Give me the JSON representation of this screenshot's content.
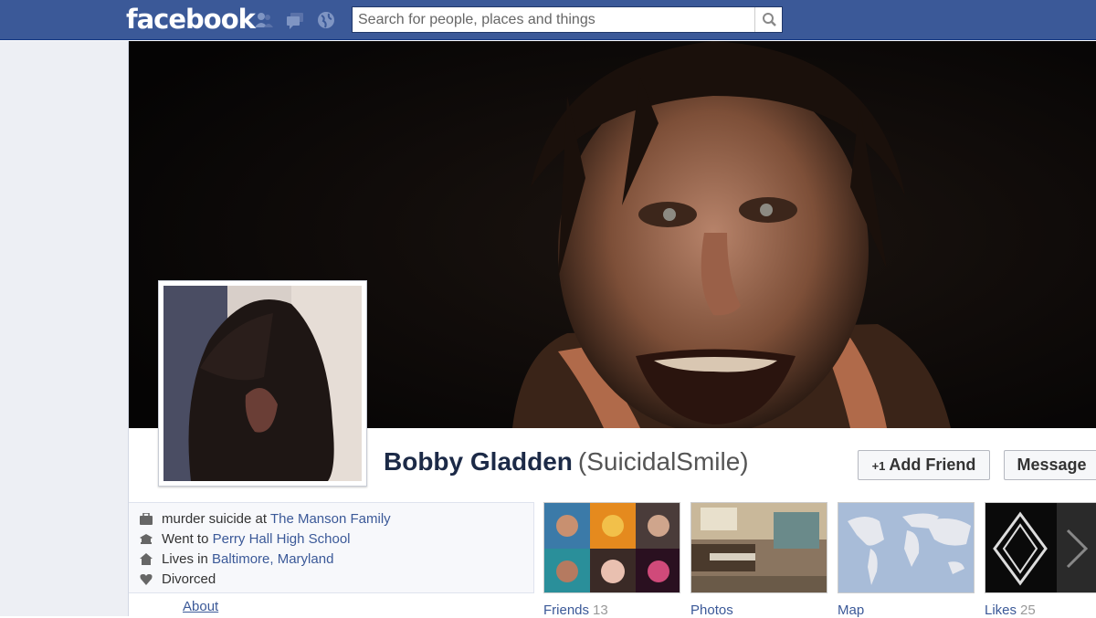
{
  "topbar": {
    "logo": "facebook",
    "search_placeholder": "Search for people, places and things",
    "icons": [
      "friend-requests-icon",
      "messages-icon",
      "notifications-globe-icon",
      "search-icon"
    ]
  },
  "profile": {
    "name": "Bobby Gladden",
    "username": "(SuicidalSmile)"
  },
  "actions": {
    "add_friend": "Add Friend",
    "add_friend_glyph": "+1",
    "message": "Message"
  },
  "about": {
    "work_prefix": "murder suicide at ",
    "work_link": "The Manson Family",
    "school_prefix": "Went to ",
    "school_link": "Perry Hall High School",
    "lives_prefix": "Lives in ",
    "lives_link": "Baltimore, Maryland",
    "relationship": "Divorced",
    "about_link": "About"
  },
  "tiles": {
    "friends_label": "Friends",
    "friends_count": "13",
    "photos_label": "Photos",
    "map_label": "Map",
    "likes_label": "Likes",
    "likes_count": "25"
  },
  "colors": {
    "brand_blue": "#3b5998",
    "link_blue": "#3b5998",
    "left_column": "#edeff4"
  }
}
